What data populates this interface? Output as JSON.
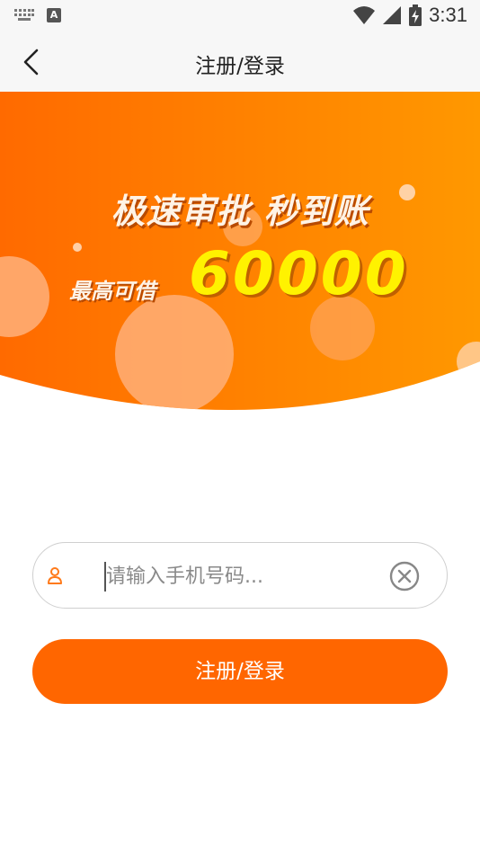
{
  "status_bar": {
    "time": "3:31",
    "icons": [
      "keyboard-icon",
      "text-input-a-icon",
      "wifi-icon",
      "signal-icon",
      "battery-charging-icon"
    ]
  },
  "header": {
    "title": "注册/登录",
    "back_icon": "chevron-left-icon"
  },
  "banner": {
    "slogan": "极速审批 秒到账",
    "prefix": "最高可借",
    "amount": "60000"
  },
  "phone_field": {
    "placeholder": "请输入手机号码...",
    "value": "",
    "icon": "user-icon",
    "clear_icon": "clear-circle-icon"
  },
  "submit": {
    "label": "注册/登录"
  },
  "colors": {
    "accent": "#ff6600",
    "banner_start": "#ff6a00",
    "banner_end": "#ff9800",
    "amount_yellow": "#fff200",
    "header_bg": "#f7f7f7"
  }
}
